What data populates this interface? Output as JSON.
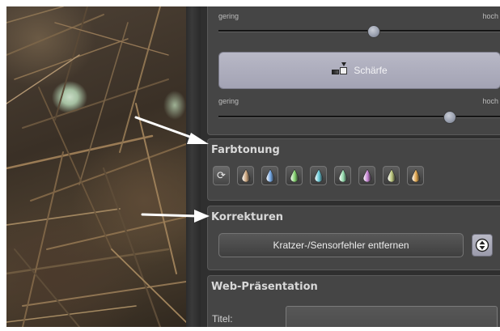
{
  "sharpness_top_slider": {
    "min_label": "gering",
    "max_label": "hoch",
    "value": 0.55
  },
  "scharfe_button": {
    "label": "Schärfe",
    "icon": "sharpness-icon"
  },
  "sharpness_bottom_slider": {
    "min_label": "gering",
    "max_label": "hoch",
    "value": 0.82
  },
  "farbtonung": {
    "title": "Farbtonung",
    "tones": [
      {
        "name": "cycle-icon",
        "color": null
      },
      {
        "name": "brown-tone-icon",
        "color": "#c9a27a"
      },
      {
        "name": "blue-tone-icon",
        "color": "#6fa3e0"
      },
      {
        "name": "green-tone-icon",
        "color": "#7fd06a"
      },
      {
        "name": "cyan-tone-icon",
        "color": "#63c7d6"
      },
      {
        "name": "teal-tone-icon",
        "color": "#8fd7a8"
      },
      {
        "name": "purple-tone-icon",
        "color": "#c27fd0"
      },
      {
        "name": "olive-tone-icon",
        "color": "#b7c277"
      },
      {
        "name": "orange-tone-icon",
        "color": "#e0a44a"
      }
    ]
  },
  "korrekturen": {
    "title": "Korrekturen",
    "button_label": "Kratzer-/Sensorfehler entfernen",
    "side_icon": "settings-circle-icon"
  },
  "web_presentation": {
    "title": "Web-Präsentation",
    "title_field_label": "Titel:",
    "title_field_value": ""
  },
  "colors": {
    "panel_bg": "#2f2f2f",
    "section_bg": "#454545",
    "accent_button": "#a9a9b8"
  }
}
